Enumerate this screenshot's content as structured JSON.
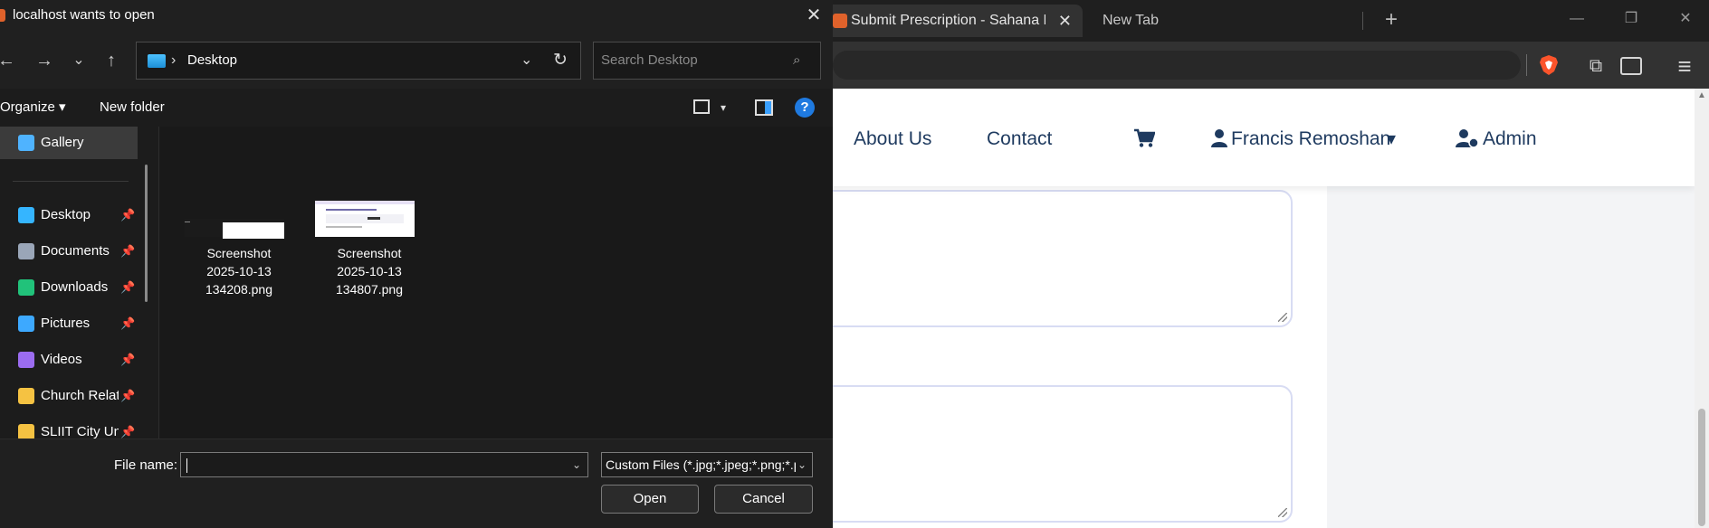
{
  "browser": {
    "active_tab_title": "Submit Prescription - Sahana Medicals",
    "active_tab_close": "✕",
    "second_tab_title": "New Tab",
    "new_tab_symbol": "+",
    "window_controls": {
      "minimize": "—",
      "restore": "❐",
      "close": "✕"
    },
    "toolbar_icons": {
      "extensions": "⧉",
      "menu": "≡"
    }
  },
  "webpage": {
    "nav": {
      "about": "About Us",
      "contact": "Contact",
      "user_name": "Francis Remoshan",
      "user_caret": "▾",
      "admin": "Admin"
    },
    "icons": {
      "cart": "🛒",
      "user": "👤",
      "admin": "👤"
    }
  },
  "dialog": {
    "title": "localhost wants to open",
    "close_symbol": "✕",
    "nav_buttons": {
      "back": "←",
      "forward": "→",
      "recent": "⌄",
      "up": "↑"
    },
    "path": {
      "chevron": "›",
      "current": "Desktop",
      "dropdown": "⌄",
      "refresh": "↻"
    },
    "search": {
      "placeholder": "Search Desktop",
      "icon": "⌕"
    },
    "commands": {
      "organize": "Organize ▾",
      "new_folder": "New folder",
      "view_dropdown": "▾",
      "help": "?"
    },
    "nav_items": [
      {
        "label": "Gallery",
        "pinned": false,
        "color": "#4fb3ff"
      },
      {
        "label": "Desktop",
        "pinned": true,
        "color": "#35b5ff"
      },
      {
        "label": "Documents",
        "pinned": true,
        "color": "#9aa6b8"
      },
      {
        "label": "Downloads",
        "pinned": true,
        "color": "#21c27a"
      },
      {
        "label": "Pictures",
        "pinned": true,
        "color": "#3da9ff"
      },
      {
        "label": "Videos",
        "pinned": true,
        "color": "#9b6cf0"
      },
      {
        "label": "Church Related",
        "pinned": true,
        "color": "#f5c242"
      },
      {
        "label": "SLIIT City Uni",
        "pinned": true,
        "color": "#f5c242"
      }
    ],
    "pin_symbol": "📌",
    "files": [
      {
        "name_line1": "Screenshot",
        "name_line2": "2025-10-13",
        "name_line3": "134208.png"
      },
      {
        "name_line1": "Screenshot",
        "name_line2": "2025-10-13",
        "name_line3": "134807.png"
      }
    ],
    "bottom": {
      "file_name_label": "File name:",
      "file_name_value": "",
      "file_type": "Custom Files (*.jpg;*.jpeg;*.png;*.pdf)",
      "dropdown": "⌄",
      "open_button": "Open",
      "cancel_button": "Cancel"
    }
  }
}
